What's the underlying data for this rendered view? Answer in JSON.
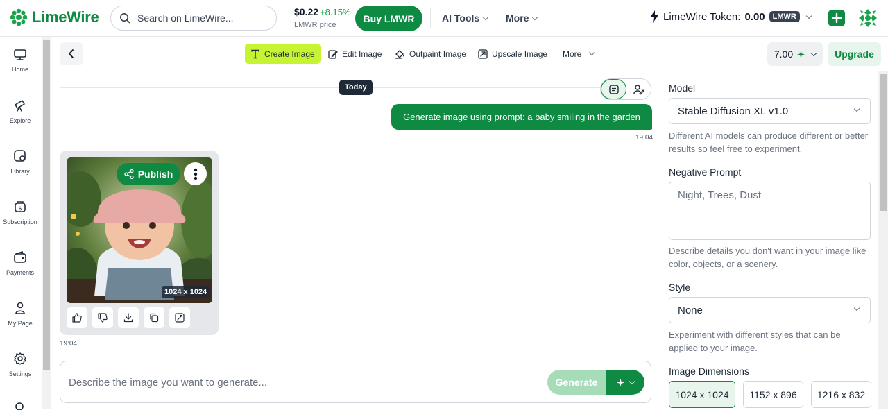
{
  "header": {
    "logo_text": "LimeWire",
    "search_placeholder": "Search on LimeWire...",
    "price": "$0.22",
    "price_change": "+8.15%",
    "price_label": "LMWR price",
    "buy_label": "Buy LMWR",
    "ai_tools_label": "AI Tools",
    "more_label": "More",
    "token_label": "LimeWire Token:",
    "token_amount": "0.00",
    "token_unit": "LMWR"
  },
  "sidebar": {
    "items": [
      {
        "label": "Home",
        "icon": "monitor-icon"
      },
      {
        "label": "Explore",
        "icon": "telescope-icon"
      },
      {
        "label": "Library",
        "icon": "library-icon"
      },
      {
        "label": "Subscription",
        "icon": "subscription-icon"
      },
      {
        "label": "Payments",
        "icon": "wallet-icon"
      },
      {
        "label": "My Page",
        "icon": "user-icon"
      },
      {
        "label": "Settings",
        "icon": "gear-icon"
      }
    ]
  },
  "toolbar": {
    "tools": [
      "Create Image",
      "Edit Image",
      "Outpaint Image",
      "Upscale Image",
      "More"
    ],
    "credits": "7.00",
    "upgrade_label": "Upgrade"
  },
  "chat": {
    "date_divider": "Today",
    "user_message": "Generate image using prompt: a baby smiling in the garden",
    "user_time": "19:04",
    "publish_label": "Publish",
    "image_dimensions": "1024 x 1024",
    "result_time": "19:04",
    "prompt_placeholder": "Describe the image you want to generate...",
    "generate_label": "Generate"
  },
  "panel": {
    "model_label": "Model",
    "model_value": "Stable Diffusion XL v1.0",
    "model_help": "Different AI models can produce different or better results so feel free to experiment.",
    "negative_label": "Negative Prompt",
    "negative_placeholder": "Night, Trees, Dust",
    "negative_help": "Describe details you don't want in your image like color, objects, or a scenery.",
    "style_label": "Style",
    "style_value": "None",
    "style_help": "Experiment with different styles that can be applied to your image.",
    "dimensions_label": "Image Dimensions",
    "dimensions": [
      "1024 x 1024",
      "1152 x 896",
      "1216 x 832"
    ]
  },
  "colors": {
    "brand_green": "#0f8a43",
    "active_tool": "#c6f432"
  }
}
